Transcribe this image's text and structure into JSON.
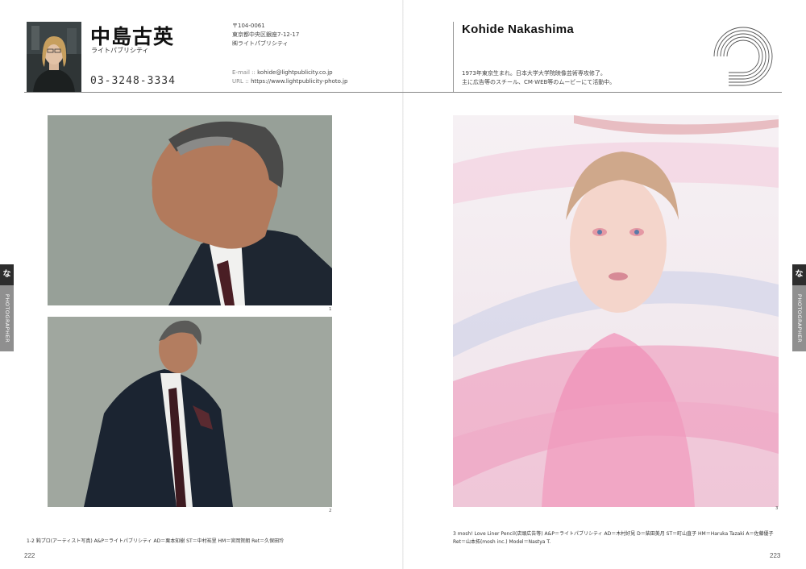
{
  "profile": {
    "name_jp": "中島古英",
    "company_jp": "ライトパブリシティ",
    "phone": "03-3248-3334",
    "address": {
      "postal": "〒104-0061",
      "line1": "東京都中央区銀座7-12-17",
      "line2": "㈱ライトパブリシティ"
    },
    "email_label": "E-mail",
    "email": "kohide@lightpublicity.co.jp",
    "url_label": "URL",
    "url": "https://www.lightpublicity-photo.jp",
    "name_en": "Kohide Nakashima",
    "bio_line1": "1973年東京生まれ。日本大学大学院映像芸術専攻修了。",
    "bio_line2": "主に広告等のスチール、CM·WEB等のムービーにて活動中。"
  },
  "side_tab": {
    "initial": "な",
    "category": "PHOTOGRAPHER"
  },
  "photos": {
    "n1": "1",
    "n2": "2",
    "n3": "3"
  },
  "credits": {
    "left": "1-2 鈍プロ(アーティスト写真)  A&P＝ライトパブリシティ  AD＝栗本知樹  ST＝中村祐里  HM＝宮岡賀朗  Ret＝久保田玲",
    "right_line1": "3 mosh! Love Liner Pencil(店頭広告等)  A&P＝ライトパブリシティ  AD＝木村好見  D＝柴田美月  ST＝町山直子  HM＝Haruka Tazaki  A＝佐藤優子",
    "right_line2": "Ret＝山本拓(mosh inc.)  Model＝Nastya T."
  },
  "folio": {
    "left": "222",
    "right": "223"
  },
  "colors": {
    "tab_dark": "#2d2d2d",
    "tab_gray": "#8f8f8f",
    "rule": "#888888"
  }
}
